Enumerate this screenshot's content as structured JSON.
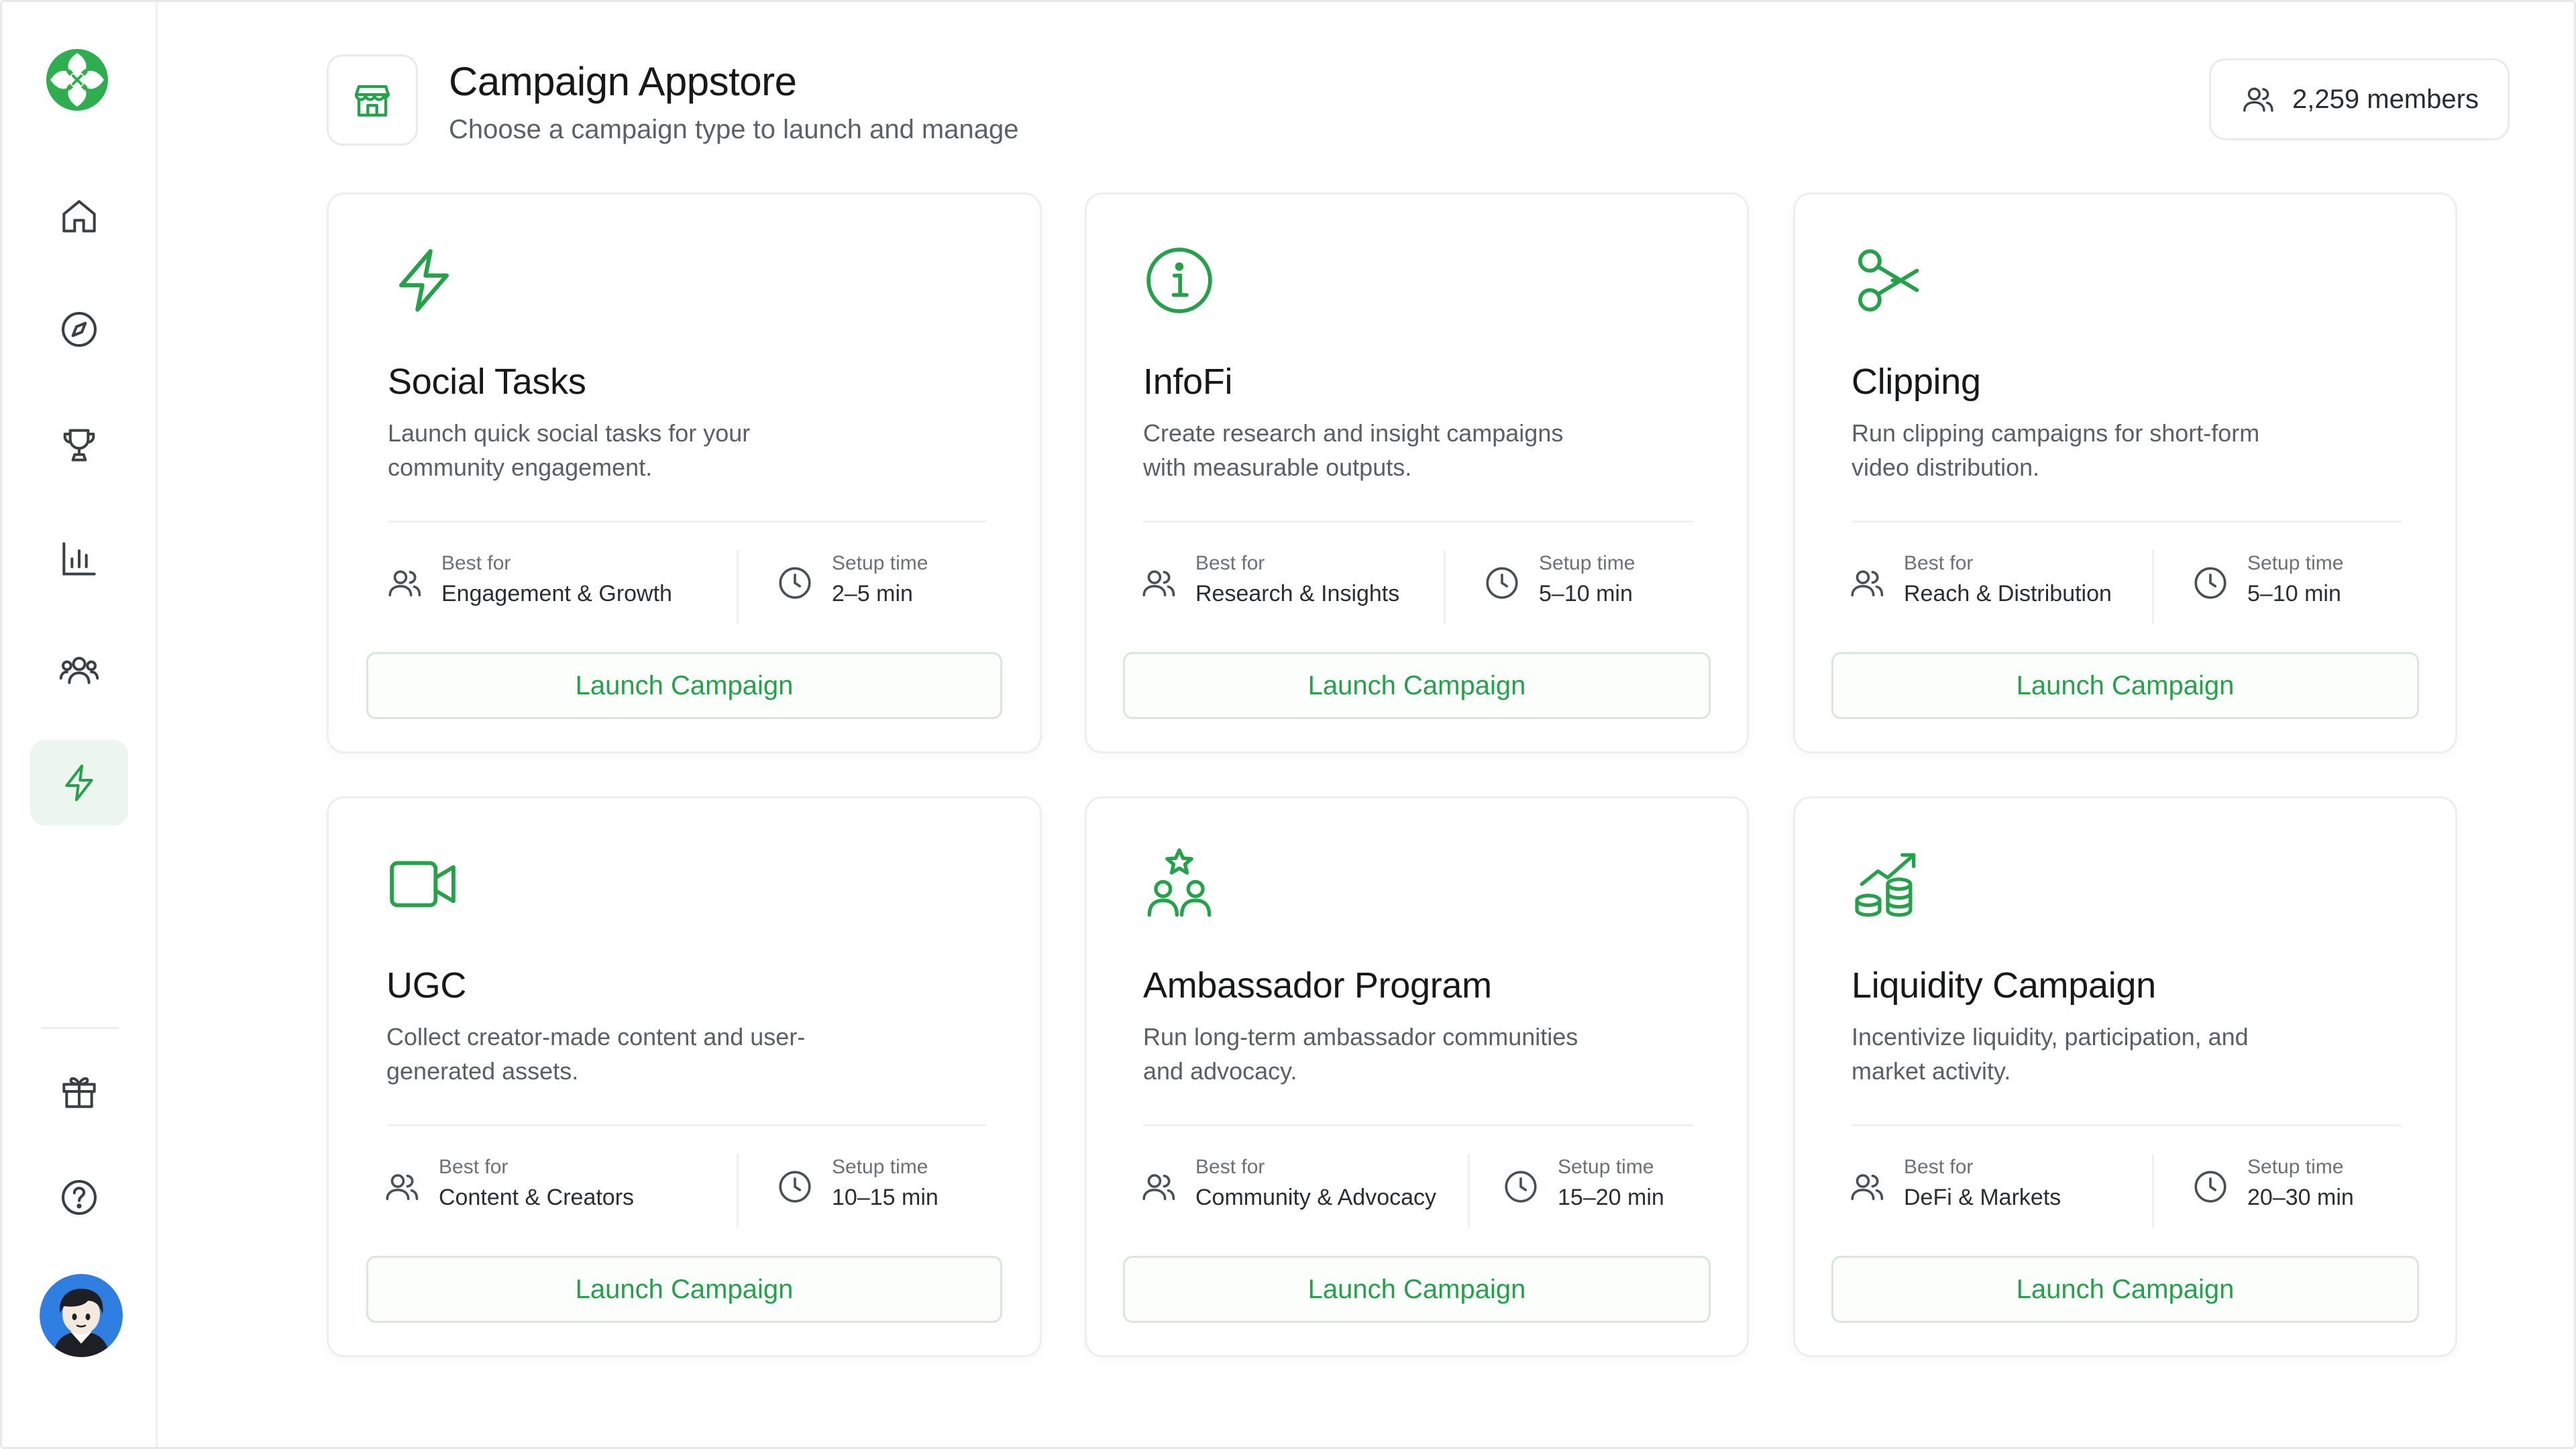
{
  "colors": {
    "accent": "#24a24a",
    "icon_gray": "#3a3f44"
  },
  "header": {
    "title": "Campaign Appstore",
    "subtitle": "Choose a campaign type to launch and manage",
    "members": "2,259 members",
    "icon": "store-icon"
  },
  "sidebar": {
    "items": [
      {
        "name": "home",
        "icon": "home-icon"
      },
      {
        "name": "explore",
        "icon": "compass-icon"
      },
      {
        "name": "rewards",
        "icon": "trophy-icon"
      },
      {
        "name": "analytics",
        "icon": "bar-chart-icon"
      },
      {
        "name": "community",
        "icon": "users-icon"
      },
      {
        "name": "campaigns",
        "icon": "lightning-icon",
        "active": true
      },
      {
        "name": "gifts",
        "icon": "gift-icon"
      },
      {
        "name": "help",
        "icon": "help-icon"
      }
    ]
  },
  "labels": {
    "best_for": "Best for",
    "setup_time": "Setup time",
    "launch": "Launch Campaign"
  },
  "cards": [
    {
      "title": "Social Tasks",
      "description": "Launch quick social tasks for your community engagement.",
      "best_for": "Engagement & Growth",
      "setup_time": "2–5 min",
      "icon": "lightning-icon"
    },
    {
      "title": "InfoFi",
      "description": "Create research and insight campaigns with measurable outputs.",
      "best_for": "Research & Insights",
      "setup_time": "5–10 min",
      "icon": "info-icon"
    },
    {
      "title": "Clipping",
      "description": "Run clipping campaigns for short-form video distribution.",
      "best_for": "Reach & Distribution",
      "setup_time": "5–10 min",
      "icon": "scissors-icon"
    },
    {
      "title": "UGC",
      "description": "Collect creator-made content and user-generated assets.",
      "best_for": "Content & Creators",
      "setup_time": "10–15 min",
      "icon": "video-icon"
    },
    {
      "title": "Ambassador Program",
      "description": "Run long-term ambassador communities and advocacy.",
      "best_for": "Community & Advocacy",
      "setup_time": "15–20 min",
      "icon": "ambassador-icon"
    },
    {
      "title": "Liquidity Campaign",
      "description": "Incentivize liquidity, participation, and market activity.",
      "best_for": "DeFi & Markets",
      "setup_time": "20–30 min",
      "icon": "liquidity-icon"
    }
  ]
}
